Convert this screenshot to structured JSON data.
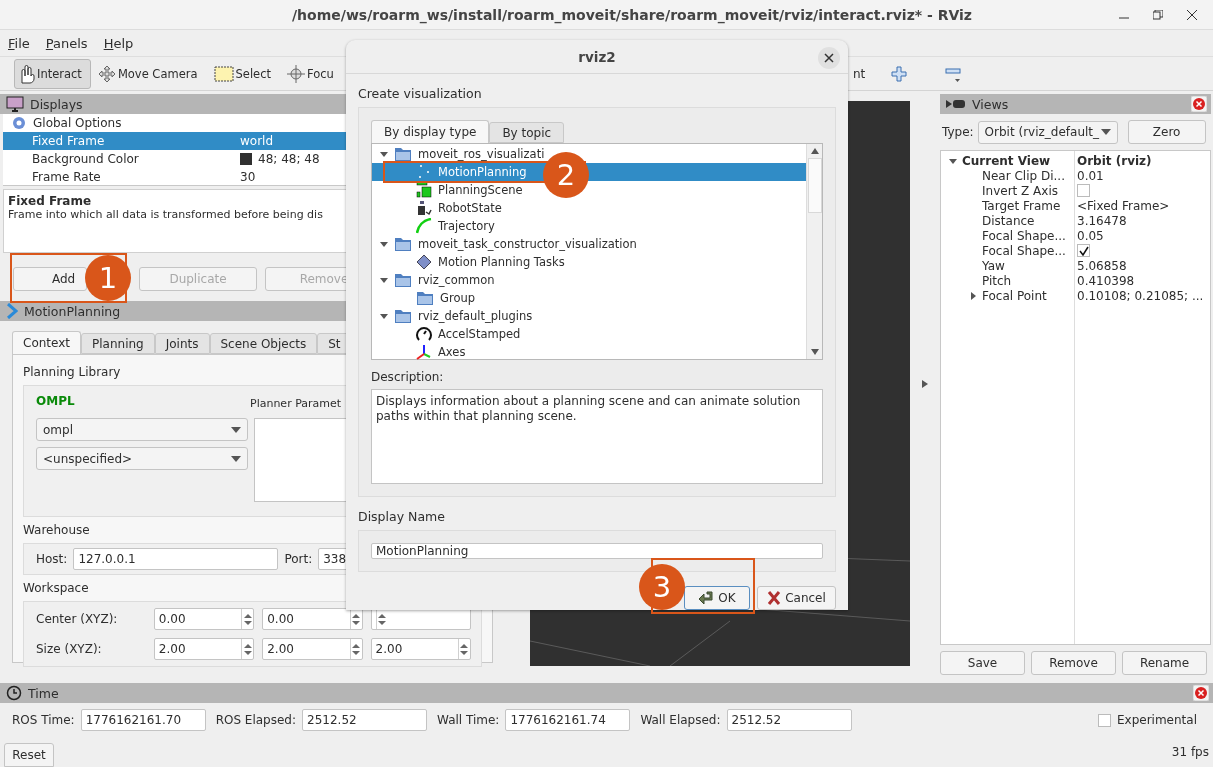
{
  "window": {
    "title": "/home/ws/roarm_ws/install/roarm_moveit/share/roarm_moveit/rviz/interact.rviz* - RViz"
  },
  "menu": [
    "File",
    "Panels",
    "Help"
  ],
  "toolbar": [
    {
      "label": "Interact",
      "selected": true
    },
    {
      "label": "Move Camera",
      "selected": false
    },
    {
      "label": "Select",
      "selected": false
    },
    {
      "label": "Focu",
      "selected": false
    }
  ],
  "toolbar_right": {
    "partial_label": "nt"
  },
  "displays": {
    "title": "Displays",
    "rows": [
      {
        "name": "Global Options",
        "kind": "group",
        "selected": false
      },
      {
        "name": "Fixed Frame",
        "kind": "property",
        "value": "world",
        "selected": true
      },
      {
        "name": "Background Color",
        "kind": "property",
        "value": "48; 48; 48",
        "color": "#303030",
        "selected": false
      },
      {
        "name": "Frame Rate",
        "kind": "property",
        "value": "30",
        "selected": false
      }
    ],
    "help_title": "Fixed Frame",
    "help_text": "Frame into which all data is transformed before being dis",
    "buttons": [
      {
        "label": "Add",
        "disabled": false
      },
      {
        "label": "Duplicate",
        "disabled": true
      },
      {
        "label": "Remove",
        "disabled": true
      }
    ]
  },
  "motion_planning": {
    "title": "MotionPlanning",
    "tabs": [
      {
        "label": "Context",
        "selected": true
      },
      {
        "label": "Planning",
        "selected": false
      },
      {
        "label": "Joints",
        "selected": false
      },
      {
        "label": "Scene Objects",
        "selected": false
      },
      {
        "label": "St",
        "selected": false
      }
    ],
    "planning_library": {
      "label": "Planning Library",
      "name": "OMPL",
      "pipeline": "ompl",
      "planner": "<unspecified>",
      "params_label": "Planner Paramet"
    },
    "warehouse": {
      "label": "Warehouse",
      "host_label": "Host:",
      "host": "127.0.0.1",
      "port_label": "Port:",
      "port": "338"
    },
    "workspace": {
      "label": "Workspace",
      "rows": [
        {
          "label": "Center (XYZ):",
          "values": [
            "0.00",
            "0.00"
          ]
        },
        {
          "label": "Size (XYZ):",
          "values": [
            "2.00",
            "2.00",
            "2.00"
          ]
        }
      ]
    }
  },
  "views": {
    "title": "Views",
    "type_label": "Type:",
    "type": "Orbit (rviz_default_",
    "zero": "Zero",
    "current": {
      "name": "Current View",
      "value": "Orbit (rviz)",
      "expanded": true
    },
    "rows": [
      {
        "name": "Near Clip Di...",
        "kind": "text",
        "value": "0.01"
      },
      {
        "name": "Invert Z Axis",
        "kind": "checkbox",
        "checked": false
      },
      {
        "name": "Target Frame",
        "kind": "text",
        "value": "<Fixed Frame>"
      },
      {
        "name": "Distance",
        "kind": "text",
        "value": "3.16478"
      },
      {
        "name": "Focal Shape...",
        "kind": "text",
        "value": "0.05"
      },
      {
        "name": "Focal Shape...",
        "kind": "checkbox",
        "checked": true
      },
      {
        "name": "Yaw",
        "kind": "text",
        "value": "5.06858"
      },
      {
        "name": "Pitch",
        "kind": "text",
        "value": "0.410398"
      },
      {
        "name": "Focal Point",
        "kind": "group",
        "expanded": false,
        "value": "0.10108; 0.21085; ..."
      }
    ],
    "buttons": [
      "Save",
      "Remove",
      "Rename"
    ]
  },
  "time": {
    "title": "Time",
    "fields": [
      {
        "label": "ROS Time:",
        "value": "1776162161.70"
      },
      {
        "label": "ROS Elapsed:",
        "value": "2512.52"
      },
      {
        "label": "Wall Time:",
        "value": "1776162161.74"
      },
      {
        "label": "Wall Elapsed:",
        "value": "2512.52"
      }
    ],
    "experimental": {
      "label": "Experimental",
      "checked": false
    },
    "reset": "Reset",
    "fps": "31 fps"
  },
  "dialog": {
    "title": "rviz2",
    "heading": "Create visualization",
    "tabs": [
      {
        "label": "By display type",
        "selected": true
      },
      {
        "label": "By topic",
        "selected": false
      }
    ],
    "tree": [
      {
        "name": "moveit_ros_visualizati",
        "expanded": true,
        "children": [
          {
            "name": "MotionPlanning",
            "kind": "dots",
            "selected": true
          },
          {
            "name": "PlanningScene",
            "kind": "scene",
            "selected": false
          },
          {
            "name": "RobotState",
            "kind": "robot",
            "selected": false
          },
          {
            "name": "Trajectory",
            "kind": "arc",
            "selected": false
          }
        ]
      },
      {
        "name": "moveit_task_constructor_visualization",
        "expanded": true,
        "children": [
          {
            "name": "Motion Planning Tasks",
            "kind": "diamond",
            "selected": false
          }
        ]
      },
      {
        "name": "rviz_common",
        "expanded": true,
        "children": [
          {
            "name": "Group",
            "kind": "folder",
            "selected": false
          }
        ]
      },
      {
        "name": "rviz_default_plugins",
        "expanded": true,
        "children": [
          {
            "name": "AccelStamped",
            "kind": "gauge",
            "selected": false
          },
          {
            "name": "Axes",
            "kind": "axes",
            "selected": false
          }
        ]
      }
    ],
    "description_label": "Description:",
    "description": "Displays information about a planning scene and can animate solution paths within that planning scene.",
    "name_label": "Display Name",
    "name_value": "MotionPlanning",
    "ok": "OK",
    "cancel": "Cancel"
  },
  "callouts": [
    {
      "number": "1"
    },
    {
      "number": "2"
    },
    {
      "number": "3"
    }
  ]
}
